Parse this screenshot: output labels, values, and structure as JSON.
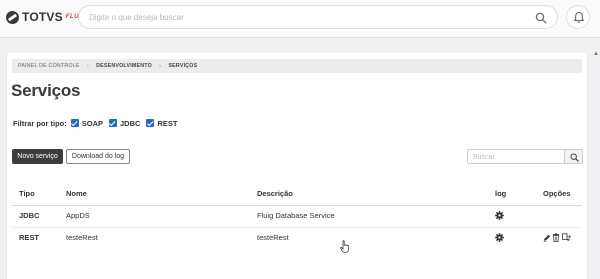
{
  "header": {
    "logo": {
      "brand": "TOTVS",
      "product": "FLUIG"
    },
    "search_placeholder": "Digite o que deseja buscar"
  },
  "breadcrumb": [
    "PAINEL DE CONTROLE",
    "DESENVOLVIMENTO",
    "SERVIÇOS"
  ],
  "page": {
    "title": "Serviços"
  },
  "filters": {
    "label": "Filtrar por tipo:",
    "options": [
      {
        "label": "SOAP",
        "checked": true
      },
      {
        "label": "JDBC",
        "checked": true
      },
      {
        "label": "REST",
        "checked": true
      }
    ]
  },
  "actions": {
    "new_service": "Novo serviço",
    "download_log": "Download do log"
  },
  "table_search_placeholder": "Buscar",
  "table": {
    "columns": [
      "Tipo",
      "Nome",
      "Descrição",
      "log",
      "Opções"
    ],
    "rows": [
      {
        "type": "JDBC",
        "name": "AppDS",
        "description": "Fluig Database Service",
        "options": []
      },
      {
        "type": "REST",
        "name": "testeRest",
        "description": "testeRest",
        "options": [
          "pencil-icon",
          "trash-icon",
          "swap-icon"
        ]
      }
    ]
  },
  "colors": {
    "accent": "#2a6bbf",
    "primary_button": "#3d3d3d",
    "brand_red": "#d0343a"
  }
}
